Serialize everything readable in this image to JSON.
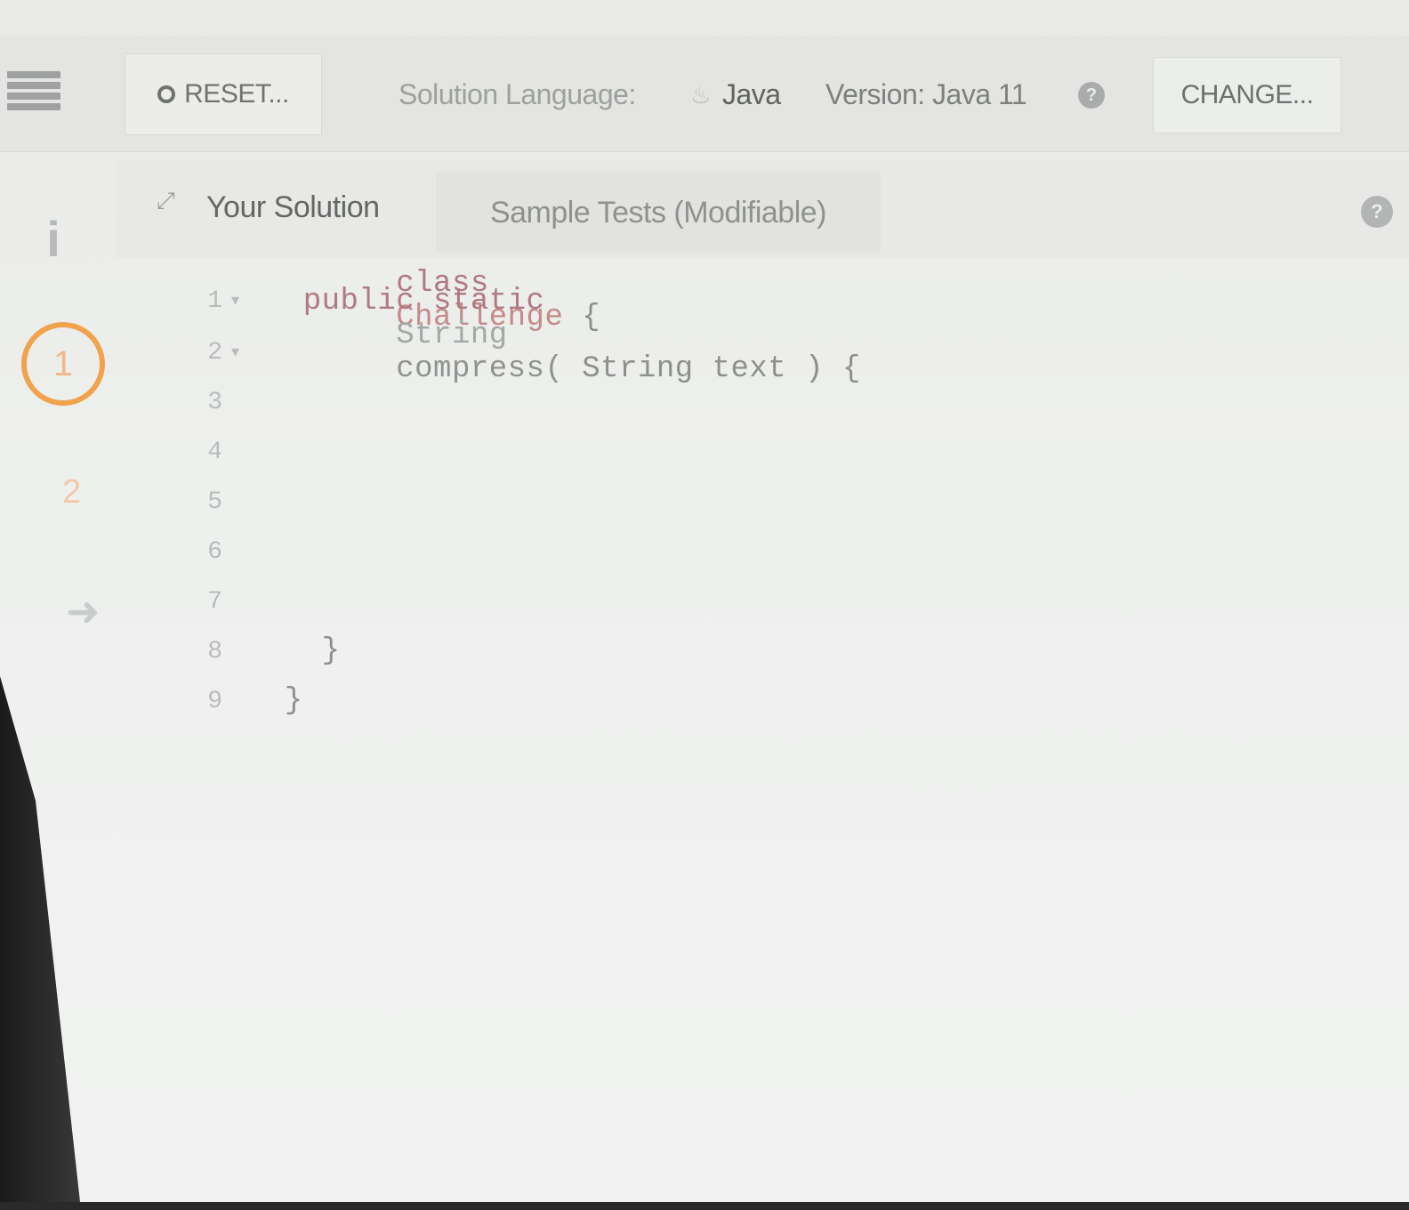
{
  "toolbar": {
    "reset_label": "RESET...",
    "solution_language_label": "Solution Language:",
    "language_value": "Java",
    "version_label": "Version: Java 11",
    "change_label": "CHANGE..."
  },
  "rail": {
    "step_current": "1",
    "step_next": "2"
  },
  "tabs": {
    "solution": "Your Solution",
    "tests": "Sample Tests (Modifiable)"
  },
  "editor": {
    "lines": [
      {
        "num": "1",
        "fold": true,
        "kw": "class",
        "name": "Challenge",
        "rest": " {"
      },
      {
        "num": "2",
        "fold": true,
        "indent": "  ",
        "kw": "public static",
        "type": "String",
        "name": "compress(",
        "rest": " String text ) {"
      },
      {
        "num": "3"
      },
      {
        "num": "4"
      },
      {
        "num": "5"
      },
      {
        "num": "6"
      },
      {
        "num": "7"
      },
      {
        "num": "8",
        "text": "    }"
      },
      {
        "num": "9",
        "text": "  }"
      }
    ]
  },
  "colors": {
    "accent_orange": "#f0a24c",
    "keyword": "#b07a82"
  }
}
